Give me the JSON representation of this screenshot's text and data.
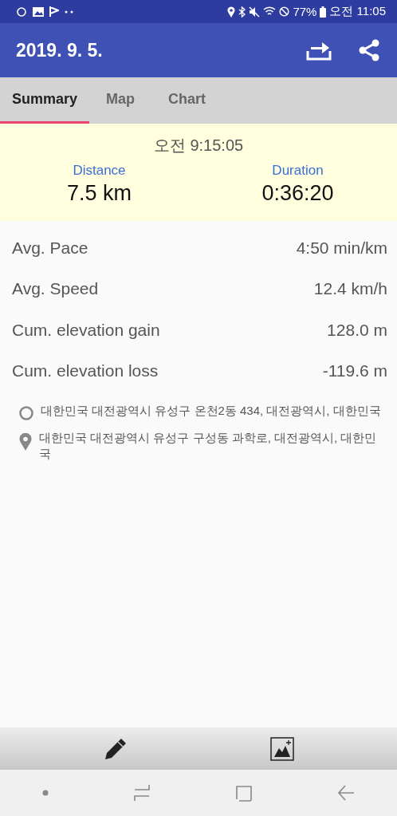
{
  "status_bar": {
    "battery": "77%",
    "time": "오전 11:05"
  },
  "app_bar": {
    "title": "2019. 9. 5."
  },
  "tabs": [
    {
      "label": "Summary",
      "selected": true
    },
    {
      "label": "Map",
      "selected": false
    },
    {
      "label": "Chart",
      "selected": false
    }
  ],
  "header": {
    "start_time": "오전 9:15:05",
    "distance": {
      "label": "Distance",
      "value": "7.5 km"
    },
    "duration": {
      "label": "Duration",
      "value": "0:36:20"
    }
  },
  "stats": [
    {
      "label": "Avg. Pace",
      "value": "4:50 min/km"
    },
    {
      "label": "Avg. Speed",
      "value": "12.4 km/h"
    },
    {
      "label": "Cum. elevation gain",
      "value": "128.0 m"
    },
    {
      "label": "Cum. elevation loss",
      "value": "-119.6 m"
    }
  ],
  "locations": [
    {
      "kind": "start",
      "address": "대한민국 대전광역시 유성구 온천2동 434, 대전광역시, 대한민국"
    },
    {
      "kind": "end",
      "address": "대한민국 대전광역시 유성구 구성동 과학로, 대전광역시, 대한민국"
    }
  ]
}
